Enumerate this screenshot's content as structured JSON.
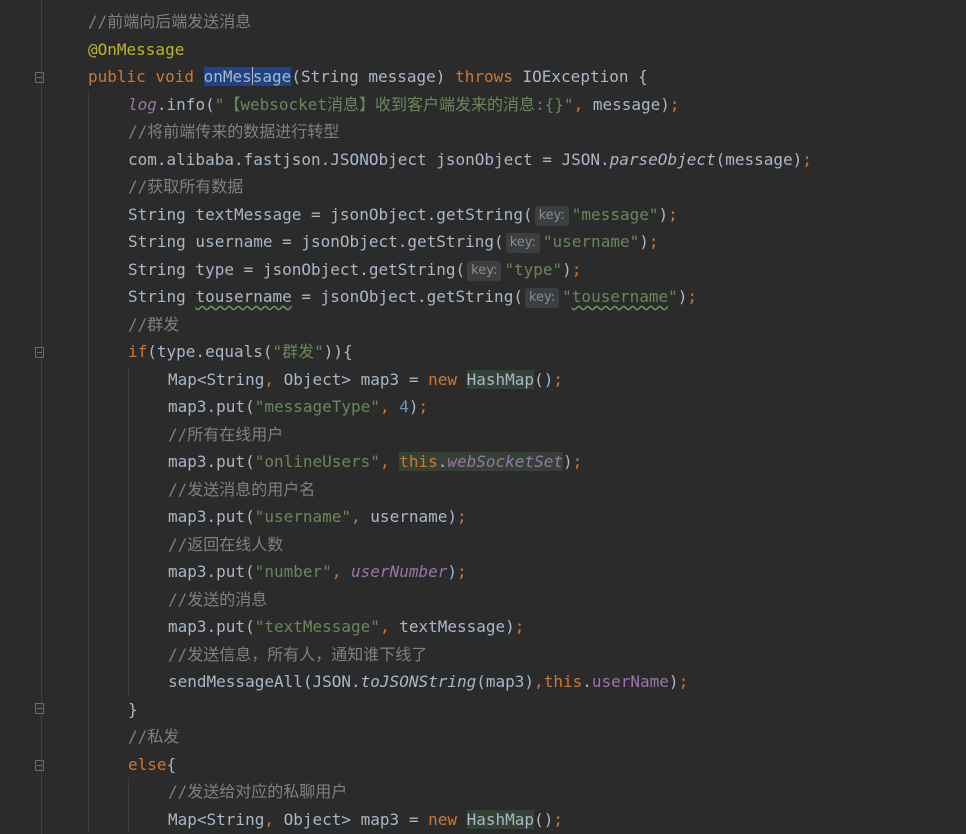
{
  "code_lines": [
    {
      "tokens": [
        {
          "t": "//前端向后端发送消息",
          "c": "cm"
        }
      ]
    },
    {
      "tokens": [
        {
          "t": "@OnMessage",
          "c": "ann"
        }
      ]
    },
    {
      "tokens": [
        {
          "t": "public ",
          "c": "kw"
        },
        {
          "t": "void ",
          "c": "kw"
        },
        {
          "t": "onMes",
          "c": "selw"
        },
        {
          "t": "",
          "c": "caret"
        },
        {
          "t": "sage",
          "c": "selw"
        },
        {
          "t": "(String message) ",
          "c": ""
        },
        {
          "t": "throws ",
          "c": "kw"
        },
        {
          "t": "IOException {",
          "c": ""
        }
      ]
    },
    {
      "tokens": [
        {
          "t": "log",
          "c": "fldi"
        },
        {
          "t": ".info(",
          "c": ""
        },
        {
          "t": "\"【websocket消息】收到客户端发来的消息:{}\"",
          "c": "str"
        },
        {
          "t": ", ",
          "c": "kw"
        },
        {
          "t": "message)",
          "c": ""
        },
        {
          "t": ";",
          "c": "kw"
        }
      ]
    },
    {
      "tokens": [
        {
          "t": "//将前端传来的数据进行转型",
          "c": "cm"
        }
      ]
    },
    {
      "tokens": [
        {
          "t": "com.alibaba.fastjson.JSONObject jsonObject = JSON.",
          "c": ""
        },
        {
          "t": "parseObject",
          "c": "sm"
        },
        {
          "t": "(message)",
          "c": ""
        },
        {
          "t": ";",
          "c": "kw"
        }
      ]
    },
    {
      "tokens": [
        {
          "t": "//获取所有数据",
          "c": "cm"
        }
      ]
    },
    {
      "tokens": [
        {
          "t": "String textMessage = jsonObject.getString(",
          "c": ""
        },
        {
          "t": "key:",
          "c": "hint"
        },
        {
          "t": "\"message\"",
          "c": "str"
        },
        {
          "t": ")",
          "c": ""
        },
        {
          "t": ";",
          "c": "kw"
        }
      ]
    },
    {
      "tokens": [
        {
          "t": "String username = jsonObject.getString(",
          "c": ""
        },
        {
          "t": "key:",
          "c": "hint"
        },
        {
          "t": "\"username\"",
          "c": "str"
        },
        {
          "t": ")",
          "c": ""
        },
        {
          "t": ";",
          "c": "kw"
        }
      ]
    },
    {
      "tokens": [
        {
          "t": "String type = jsonObject.getString(",
          "c": ""
        },
        {
          "t": "key:",
          "c": "hint"
        },
        {
          "t": "\"type\"",
          "c": "str"
        },
        {
          "t": ")",
          "c": ""
        },
        {
          "t": ";",
          "c": "kw"
        }
      ]
    },
    {
      "tokens": [
        {
          "t": "String ",
          "c": ""
        },
        {
          "t": "tousername",
          "c": "typo"
        },
        {
          "t": " = jsonObject.getString(",
          "c": ""
        },
        {
          "t": "key:",
          "c": "hint"
        },
        {
          "t": "\"",
          "c": "str"
        },
        {
          "t": "tousername",
          "c": "str typo"
        },
        {
          "t": "\"",
          "c": "str"
        },
        {
          "t": ")",
          "c": ""
        },
        {
          "t": ";",
          "c": "kw"
        }
      ]
    },
    {
      "tokens": [
        {
          "t": "//群发",
          "c": "cm"
        }
      ]
    },
    {
      "tokens": [
        {
          "t": "if",
          "c": "kw"
        },
        {
          "t": "(type.equals(",
          "c": ""
        },
        {
          "t": "\"群发\"",
          "c": "str"
        },
        {
          "t": ")){",
          "c": ""
        }
      ]
    },
    {
      "tokens": [
        {
          "t": "Map<String",
          "c": ""
        },
        {
          "t": ", ",
          "c": "kw"
        },
        {
          "t": "Object> map3 = ",
          "c": ""
        },
        {
          "t": "new ",
          "c": "kw"
        },
        {
          "t": "HashMap",
          "c": "hl"
        },
        {
          "t": "()",
          "c": ""
        },
        {
          "t": ";",
          "c": "kw"
        }
      ]
    },
    {
      "tokens": [
        {
          "t": "map3.put(",
          "c": ""
        },
        {
          "t": "\"messageType\"",
          "c": "str"
        },
        {
          "t": ", ",
          "c": "kw"
        },
        {
          "t": "4",
          "c": "num"
        },
        {
          "t": ")",
          "c": ""
        },
        {
          "t": ";",
          "c": "kw"
        }
      ]
    },
    {
      "tokens": [
        {
          "t": "//所有在线用户",
          "c": "cm"
        }
      ]
    },
    {
      "tokens": [
        {
          "t": "map3.put(",
          "c": ""
        },
        {
          "t": "\"onlineUsers\"",
          "c": "str"
        },
        {
          "t": ", ",
          "c": "kw"
        },
        {
          "t": "this",
          "c": "kw hl"
        },
        {
          "t": ".",
          "c": "hl"
        },
        {
          "t": "webSocketSet",
          "c": "fldi hl"
        },
        {
          "t": ")",
          "c": ""
        },
        {
          "t": ";",
          "c": "kw"
        }
      ]
    },
    {
      "tokens": [
        {
          "t": "//发送消息的用户名",
          "c": "cm"
        }
      ]
    },
    {
      "tokens": [
        {
          "t": "map3.put(",
          "c": ""
        },
        {
          "t": "\"username\"",
          "c": "str"
        },
        {
          "t": ", ",
          "c": "kw"
        },
        {
          "t": "username)",
          "c": ""
        },
        {
          "t": ";",
          "c": "kw"
        }
      ]
    },
    {
      "tokens": [
        {
          "t": "//返回在线人数",
          "c": "cm"
        }
      ]
    },
    {
      "tokens": [
        {
          "t": "map3.put(",
          "c": ""
        },
        {
          "t": "\"number\"",
          "c": "str"
        },
        {
          "t": ", ",
          "c": "kw"
        },
        {
          "t": "userNumber",
          "c": "fldi"
        },
        {
          "t": ")",
          "c": ""
        },
        {
          "t": ";",
          "c": "kw"
        }
      ]
    },
    {
      "tokens": [
        {
          "t": "//发送的消息",
          "c": "cm"
        }
      ]
    },
    {
      "tokens": [
        {
          "t": "map3.put(",
          "c": ""
        },
        {
          "t": "\"textMessage\"",
          "c": "str"
        },
        {
          "t": ", ",
          "c": "kw"
        },
        {
          "t": "textMessage)",
          "c": ""
        },
        {
          "t": ";",
          "c": "kw"
        }
      ]
    },
    {
      "tokens": [
        {
          "t": "//发送信息，所有人，通知谁下线了",
          "c": "cm"
        }
      ]
    },
    {
      "tokens": [
        {
          "t": "sendMessageAll(JSON.",
          "c": ""
        },
        {
          "t": "toJSONString",
          "c": "sm"
        },
        {
          "t": "(map3)",
          "c": ""
        },
        {
          "t": ",",
          "c": "kw"
        },
        {
          "t": "this",
          "c": "kw"
        },
        {
          "t": ".",
          "c": ""
        },
        {
          "t": "userName",
          "c": "fld"
        },
        {
          "t": ")",
          "c": ""
        },
        {
          "t": ";",
          "c": "kw"
        }
      ]
    },
    {
      "tokens": [
        {
          "t": "}",
          "c": ""
        }
      ]
    },
    {
      "tokens": [
        {
          "t": "//私发",
          "c": "cm"
        }
      ]
    },
    {
      "tokens": [
        {
          "t": "else",
          "c": "kw"
        },
        {
          "t": "{",
          "c": ""
        }
      ]
    },
    {
      "tokens": [
        {
          "t": "//发送给对应的私聊用户",
          "c": "cm"
        }
      ]
    },
    {
      "tokens": [
        {
          "t": "Map<String",
          "c": ""
        },
        {
          "t": ", ",
          "c": "kw"
        },
        {
          "t": "Object> map3 = ",
          "c": ""
        },
        {
          "t": "new ",
          "c": "kw"
        },
        {
          "t": "HashMap",
          "c": "hl"
        },
        {
          "t": "()",
          "c": ""
        },
        {
          "t": ";",
          "c": "kw"
        }
      ]
    }
  ]
}
